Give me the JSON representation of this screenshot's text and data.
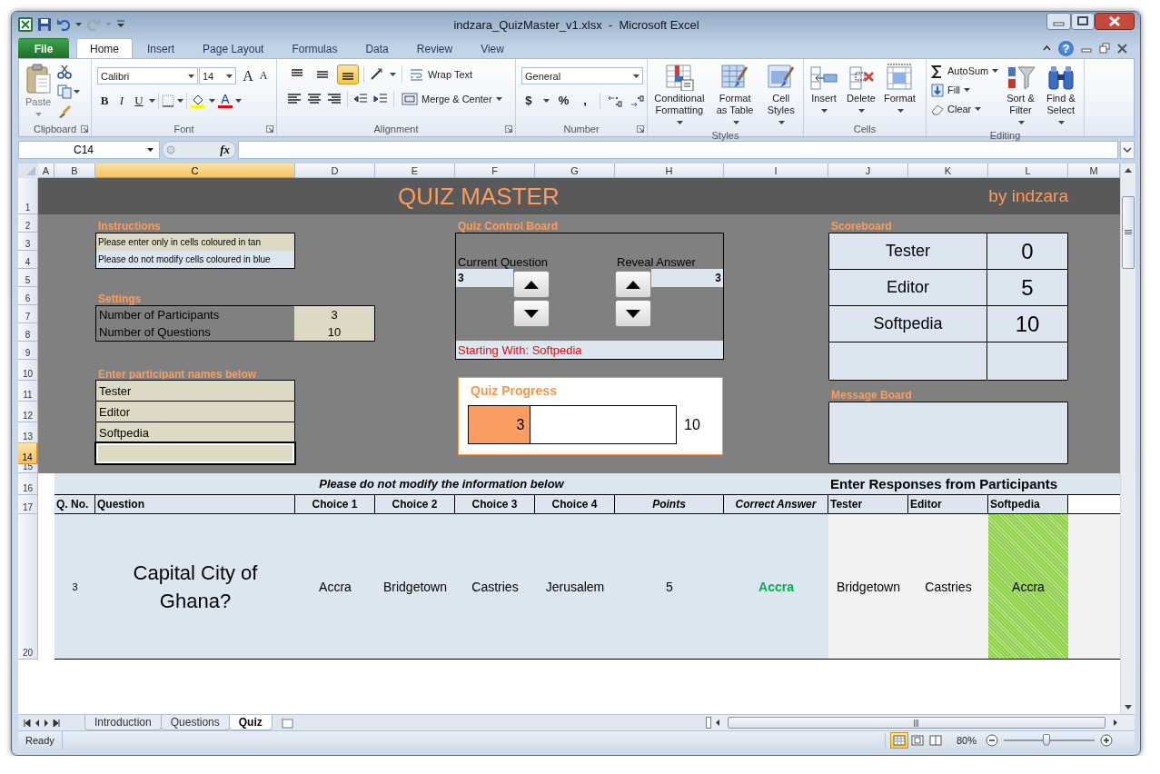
{
  "window": {
    "title": "indzara_QuizMaster_v1.xlsx  -  Microsoft Excel"
  },
  "ribbon": {
    "tabs": [
      {
        "label": "File",
        "kind": "file",
        "selected": false
      },
      {
        "label": "Home",
        "kind": "tab",
        "selected": true
      },
      {
        "label": "Insert",
        "kind": "tab",
        "selected": false
      },
      {
        "label": "Page Layout",
        "kind": "tab",
        "selected": false
      },
      {
        "label": "Formulas",
        "kind": "tab",
        "selected": false
      },
      {
        "label": "Data",
        "kind": "tab",
        "selected": false
      },
      {
        "label": "Review",
        "kind": "tab",
        "selected": false
      },
      {
        "label": "View",
        "kind": "tab",
        "selected": false
      }
    ],
    "help": "?",
    "groups": [
      {
        "kind": "clipboard",
        "label": "Clipboard",
        "launcher": true,
        "paste": "Paste"
      },
      {
        "kind": "font",
        "label": "Font",
        "launcher": true,
        "font": "Calibri",
        "size": "14",
        "grow": "A",
        "shrink": "A",
        "bold": "B",
        "italic": "I",
        "underline": "U",
        "font_color": "A"
      },
      {
        "kind": "alignment",
        "label": "Alignment",
        "launcher": true,
        "vertical_align": [
          {
            "kind": "top",
            "selected": false
          },
          {
            "kind": "middle",
            "selected": false
          },
          {
            "kind": "bottom",
            "selected": true
          }
        ],
        "wrap_text": "Wrap Text",
        "merge": "Merge & Center"
      },
      {
        "kind": "number",
        "label": "Number",
        "launcher": true,
        "format": "General",
        "currency": "$",
        "percent": "%",
        "comma": ","
      },
      {
        "kind": "styles",
        "label": "Styles",
        "launcher": false,
        "buttons": [
          {
            "kind": "conditional",
            "lines": [
              "Conditional",
              "Formatting"
            ]
          },
          {
            "kind": "table",
            "lines": [
              "Format",
              "as Table"
            ]
          },
          {
            "kind": "cell_styles",
            "lines": [
              "Cell",
              "Styles"
            ]
          }
        ]
      },
      {
        "kind": "cells",
        "label": "Cells",
        "launcher": false,
        "buttons": [
          {
            "kind": "insert",
            "lines": [
              "Insert"
            ]
          },
          {
            "kind": "delete",
            "lines": [
              "Delete"
            ]
          },
          {
            "kind": "format",
            "lines": [
              "Format"
            ]
          }
        ]
      },
      {
        "kind": "editing",
        "label": "Editing",
        "launcher": false,
        "small": [
          {
            "kind": "autosum",
            "label": "AutoSum"
          },
          {
            "kind": "fill",
            "label": "Fill"
          },
          {
            "kind": "clear",
            "label": "Clear"
          }
        ],
        "buttons": [
          {
            "kind": "sort",
            "lines": [
              "Sort &",
              "Filter"
            ]
          },
          {
            "kind": "find",
            "lines": [
              "Find &",
              "Select"
            ]
          }
        ]
      }
    ]
  },
  "formula_bar": {
    "name_box": "C14",
    "function_label": "fx"
  },
  "sheet": {
    "column_headers": [
      {
        "label": "A",
        "selected": false
      },
      {
        "label": "B",
        "selected": false
      },
      {
        "label": "C",
        "selected": true
      },
      {
        "label": "D",
        "selected": false
      },
      {
        "label": "E",
        "selected": false
      },
      {
        "label": "F",
        "selected": false
      },
      {
        "label": "G",
        "selected": false
      },
      {
        "label": "H",
        "selected": false
      },
      {
        "label": "I",
        "selected": false
      },
      {
        "label": "J",
        "selected": false
      },
      {
        "label": "K",
        "selected": false
      },
      {
        "label": "L",
        "selected": false
      },
      {
        "label": "M",
        "selected": false
      }
    ],
    "row_headers": [
      {
        "label": "1",
        "selected": false
      },
      {
        "label": "2",
        "selected": false
      },
      {
        "label": "3",
        "selected": false
      },
      {
        "label": "4",
        "selected": false
      },
      {
        "label": "5",
        "selected": false
      },
      {
        "label": "6",
        "selected": false
      },
      {
        "label": "7",
        "selected": false
      },
      {
        "label": "8",
        "selected": false
      },
      {
        "label": "9",
        "selected": false
      },
      {
        "label": "10",
        "selected": false
      },
      {
        "label": "11",
        "selected": false
      },
      {
        "label": "12",
        "selected": false
      },
      {
        "label": "13",
        "selected": false
      },
      {
        "label": "14",
        "selected": true
      },
      {
        "label": "15",
        "selected": false
      },
      {
        "label": "16",
        "selected": false
      },
      {
        "label": "17",
        "selected": false
      },
      {
        "label": "20",
        "selected": false
      }
    ],
    "title": "QUIZ MASTER",
    "credit": "by indzara",
    "instructions": {
      "label": "Instructions",
      "lines": [
        {
          "text": "Please enter only in cells coloured in tan",
          "kind": "tan"
        },
        {
          "text": "Please do not modify cells coloured in blue",
          "kind": "blue"
        }
      ]
    },
    "settings": {
      "label": "Settings",
      "rows": [
        {
          "label": "Number of Participants",
          "value": "3"
        },
        {
          "label": "Number of Questions",
          "value": "10"
        }
      ]
    },
    "participants": {
      "label": "Enter participant names below",
      "cells": [
        {
          "kind": "name",
          "name": "Tester",
          "selected": false
        },
        {
          "kind": "name",
          "name": "Editor",
          "selected": false
        },
        {
          "kind": "name",
          "name": "Softpedia",
          "selected": false
        },
        {
          "kind": "blank",
          "selected": true
        }
      ]
    },
    "control_board": {
      "label": "Quiz Control Board",
      "current_label": "Current Question",
      "current_value": "3",
      "reveal_label": "Reveal Answer",
      "reveal_value": "3",
      "status": "Starting With: Softpedia"
    },
    "progress": {
      "label": "Quiz Progress",
      "value": "3",
      "total": "10",
      "level": 0.3
    },
    "scoreboard": {
      "label": "Scoreboard",
      "rows": [
        {
          "kind": "player",
          "name": "Tester",
          "score": "0"
        },
        {
          "kind": "player",
          "name": "Editor",
          "score": "5"
        },
        {
          "kind": "player",
          "name": "Softpedia",
          "score": "10"
        },
        {
          "kind": "blank"
        }
      ]
    },
    "message_board": {
      "label": "Message Board"
    }
  },
  "questions_table": {
    "notice": "Please do not modify the information below",
    "responses_title": "Enter Responses from Participants",
    "columns": [
      {
        "label": "Q. No.",
        "kind": "text"
      },
      {
        "label": "Question",
        "kind": "text"
      },
      {
        "label": "Choice 1",
        "kind": "choice"
      },
      {
        "label": "Choice 2",
        "kind": "choice"
      },
      {
        "label": "Choice 3",
        "kind": "choice"
      },
      {
        "label": "Choice 4",
        "kind": "choice"
      },
      {
        "label": "Points",
        "kind": "meta"
      },
      {
        "label": "Correct Answer",
        "kind": "meta"
      },
      {
        "label": "Tester",
        "kind": "text"
      },
      {
        "label": "Editor",
        "kind": "text"
      },
      {
        "label": "Softpedia",
        "kind": "text"
      }
    ],
    "row": {
      "number": "3",
      "question": "Capital City of Ghana?",
      "choices": [
        "Accra",
        "Bridgetown",
        "Castries",
        "Jerusalem"
      ],
      "points": "5",
      "answer": "Accra",
      "responses": [
        {
          "text": "Bridgetown",
          "correct": false
        },
        {
          "text": "Castries",
          "correct": false
        },
        {
          "text": "Accra",
          "correct": true
        }
      ]
    }
  },
  "sheet_tabs": [
    {
      "label": "Introduction",
      "selected": false
    },
    {
      "label": "Questions",
      "selected": false
    },
    {
      "label": "Quiz",
      "selected": true
    }
  ],
  "status_bar": {
    "text": "Ready",
    "views": [
      {
        "kind": "normal",
        "selected": true
      },
      {
        "kind": "page_layout",
        "selected": false
      },
      {
        "kind": "page_break",
        "selected": false
      }
    ],
    "zoom": "80%",
    "zoom_slider": {
      "level": 0.47
    }
  }
}
